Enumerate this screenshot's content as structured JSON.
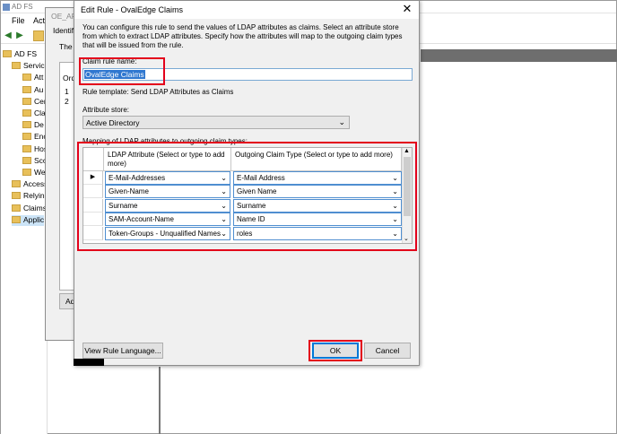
{
  "mmc": {
    "title": "AD FS",
    "menu": [
      "File",
      "Acti"
    ],
    "tree": [
      {
        "label": "AD FS",
        "indent": 0
      },
      {
        "label": "Service",
        "indent": 1
      },
      {
        "label": "Att",
        "indent": 2
      },
      {
        "label": "Au",
        "indent": 2
      },
      {
        "label": "Cer",
        "indent": 2
      },
      {
        "label": "Cla",
        "indent": 2
      },
      {
        "label": "De",
        "indent": 2
      },
      {
        "label": "Enc",
        "indent": 2
      },
      {
        "label": "Hos",
        "indent": 2
      },
      {
        "label": "Sco",
        "indent": 2
      },
      {
        "label": "We",
        "indent": 2
      },
      {
        "label": "Access",
        "indent": 1
      },
      {
        "label": "Relying",
        "indent": 1
      },
      {
        "label": "Claims",
        "indent": 1
      },
      {
        "label": "Applic",
        "indent": 1
      }
    ]
  },
  "props": {
    "title": "OE_API",
    "tab": "Identifi",
    "intro": "The f",
    "col_order": "Ord",
    "rows": [
      "1",
      "2"
    ],
    "add_label": "Ad"
  },
  "dialog": {
    "title": "Edit Rule - OvalEdge Claims",
    "close": "✕",
    "description": "You can configure this rule to send the values of LDAP attributes as claims. Select an attribute store from which to extract LDAP attributes. Specify how the attributes will map to the outgoing claim types that will be issued from the rule.",
    "claim_rule_name_label": "Claim rule name:",
    "claim_rule_name_value": "OvalEdge Claims",
    "rule_template": "Rule template: Send LDAP Attributes as Claims",
    "attribute_store_label": "Attribute store:",
    "attribute_store_value": "Active Directory",
    "mapping_label": "Mapping of LDAP attributes to outgoing claim types:",
    "col_ldap": "LDAP Attribute (Select or type to add more)",
    "col_claim": "Outgoing Claim Type (Select or type to add more)",
    "mappings": [
      {
        "ldap": "E-Mail-Addresses",
        "claim": "E-Mail Address",
        "marker": "▶"
      },
      {
        "ldap": "Given-Name",
        "claim": "Given Name",
        "marker": ""
      },
      {
        "ldap": "Surname",
        "claim": "Surname",
        "marker": ""
      },
      {
        "ldap": "SAM-Account-Name",
        "claim": "Name ID",
        "marker": ""
      },
      {
        "ldap": "Token-Groups - Unqualified Names",
        "claim": "roles",
        "marker": ""
      }
    ],
    "view_rule_language": "View Rule Language...",
    "ok": "OK",
    "cancel": "Cancel"
  },
  "colors": {
    "highlight": "#e3001b",
    "selection": "#3078d0"
  }
}
